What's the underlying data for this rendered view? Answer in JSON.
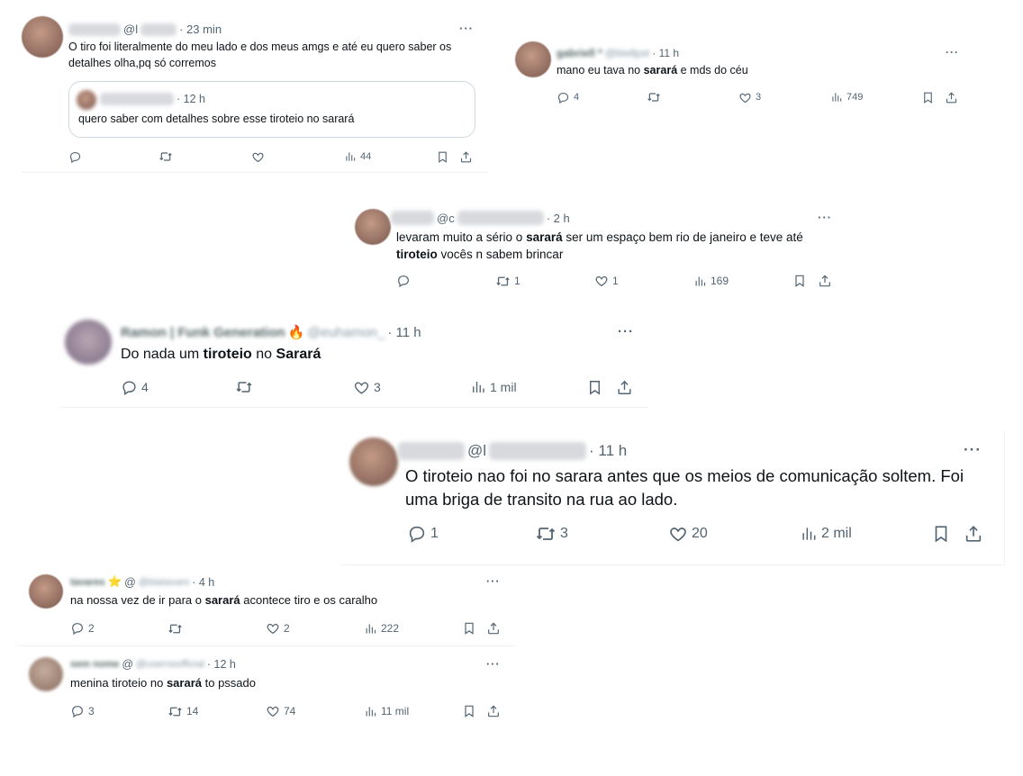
{
  "tweets": [
    {
      "handle_prefix": "@l",
      "time": "· 23 min",
      "text": "O tiro foi literalmente do meu lado e dos meus amgs e até eu quero saber os detalhes olha,pq só corremos",
      "quote": {
        "time": "· 12 h",
        "text": "quero saber com detalhes sobre esse tiroteio no sarará"
      },
      "replies": "",
      "retweets": "",
      "likes": "",
      "views": "44",
      "more": "···"
    },
    {
      "name": "gabriell *",
      "handle": "@biellpxt",
      "time": "· 11 h",
      "text_parts": [
        "mano eu tava no ",
        "sarará",
        " e mds do céu"
      ],
      "replies": "4",
      "retweets": "",
      "likes": "3",
      "views": "749",
      "more": "···"
    },
    {
      "handle_prefix": "@c",
      "time": "· 2 h",
      "text_parts": [
        "levaram muito a sério o ",
        "sarará",
        " ser um espaço bem rio de janeiro e teve até ",
        "tiroteio",
        " vocês n sabem brincar"
      ],
      "replies": "",
      "retweets": "1",
      "likes": "1",
      "views": "169",
      "more": "···"
    },
    {
      "name": "Ramon | Funk Generation",
      "handle": "@euhamon_",
      "time": "· 11 h",
      "text_parts": [
        "Do nada um ",
        "tiroteio",
        " no ",
        "Sarará"
      ],
      "replies": "4",
      "retweets": "",
      "likes": "3",
      "views": "1 mil",
      "more": "···"
    },
    {
      "handle_prefix": "@l",
      "time": "· 11 h",
      "text": "O tiroteio nao foi no sarara antes que os meios de comunicação soltem. Foi uma briga de transito na rua ao lado.",
      "replies": "1",
      "retweets": "3",
      "likes": "20",
      "views": "2 mil",
      "more": "···"
    },
    {
      "name": "tavares",
      "handle": "@biatavaro",
      "time": "· 4 h",
      "text_parts": [
        "na nossa vez de ir para o ",
        "sarará",
        " acontece tiro e os caralho"
      ],
      "replies": "2",
      "retweets": "",
      "likes": "2",
      "views": "222",
      "more": "···"
    },
    {
      "name": "sem nome",
      "handle": "@usernoofficial",
      "time": "· 12 h",
      "text_parts": [
        "menina tiroteio no ",
        "sarará",
        " to pssado"
      ],
      "replies": "3",
      "retweets": "14",
      "likes": "74",
      "views": "11 mil",
      "more": "···"
    }
  ],
  "icons": {
    "reply": "reply-icon",
    "retweet": "retweet-icon",
    "like": "heart-icon",
    "views": "views-icon",
    "bookmark": "bookmark-icon",
    "share": "share-icon",
    "emoji_fire": "🔥",
    "emoji_star": "⭐"
  },
  "colors": {
    "text": "#0f1419",
    "muted": "#536471",
    "border": "#eff3f4"
  }
}
